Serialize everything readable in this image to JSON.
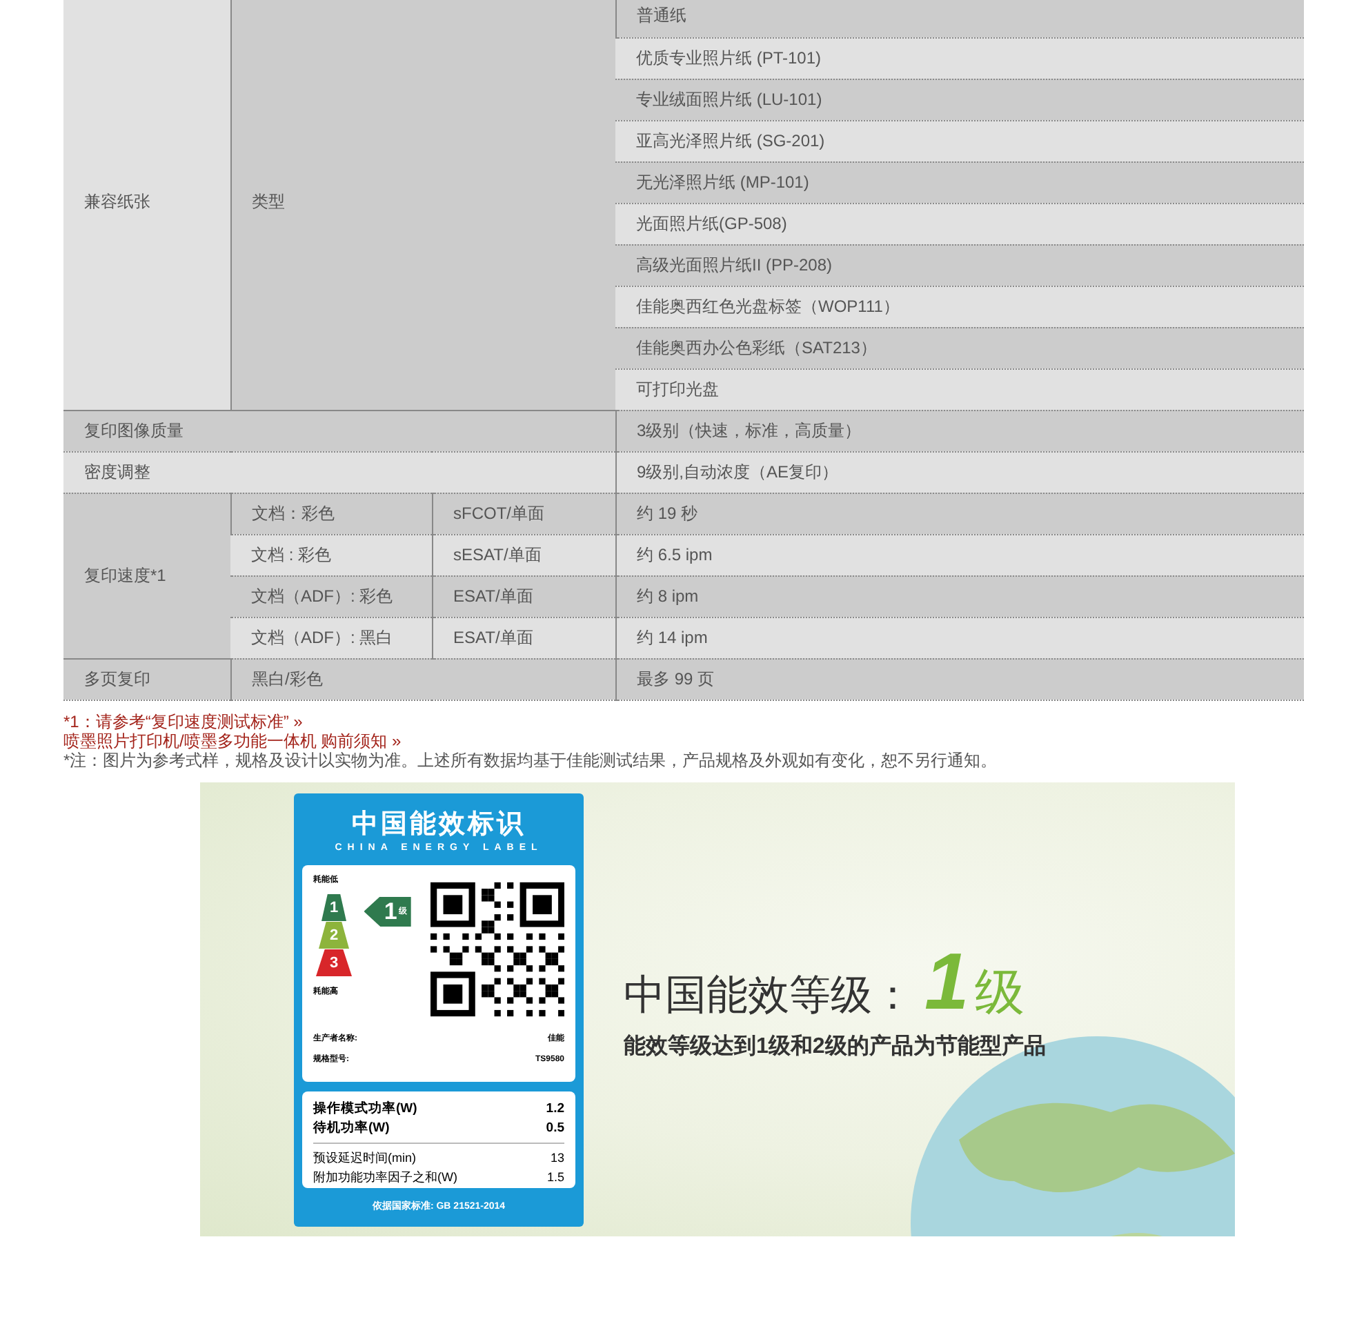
{
  "spec_table": {
    "rows": [
      {
        "kind": "paper",
        "label": "兼容纸张",
        "sub_label": "类型",
        "values": [
          "普通纸",
          "优质专业照片纸 (PT-101)",
          "专业绒面照片纸 (LU-101)",
          "亚高光泽照片纸 (SG-201)",
          "无光泽照片纸 (MP-101)",
          "光面照片纸(GP-508)",
          "高级光面照片纸II (PP-208)",
          "佳能奥西红色光盘标签（WOP111）",
          "佳能奥西办公色彩纸（SAT213）",
          "可打印光盘"
        ]
      },
      {
        "kind": "simple",
        "label": "复印图像质量",
        "value": "3级别（快速，标准，高质量）"
      },
      {
        "kind": "simple",
        "label": "密度调整",
        "value": "9级别,自动浓度（AE复印）"
      },
      {
        "kind": "speed",
        "label": "复印速度*1",
        "items": [
          {
            "mode": "文档：彩色",
            "measure": "sFCOT/单面",
            "value": "约 19 秒"
          },
          {
            "mode": "文档 : 彩色",
            "measure": "sESAT/单面",
            "value": "约 6.5 ipm"
          },
          {
            "mode": "文档（ADF）: 彩色",
            "measure": "ESAT/单面",
            "value": "约 8 ipm"
          },
          {
            "mode": "文档（ADF）: 黑白",
            "measure": "ESAT/单面",
            "value": "约 14 ipm"
          }
        ]
      },
      {
        "kind": "pair",
        "label": "多页复印",
        "sub_label": "黑白/彩色",
        "value": "最多 99 页"
      }
    ]
  },
  "notes": [
    {
      "kind": "link",
      "text": "*1：请参考“复印速度测试标准” »"
    },
    {
      "kind": "link",
      "text": "喷墨照片打印机/喷墨多功能一体机 购前须知 »"
    },
    {
      "kind": "plain",
      "text": "*注：图片为参考式样，规格及设计以实物为准。上述所有数据均基于佳能测试结果，产品规格及外观如有变化，恕不另行通知。"
    }
  ],
  "energy_banner": {
    "label": {
      "title": "中国能效标识",
      "subtitle": "CHINA ENERGY LABEL",
      "low_label": "耗能低",
      "high_label": "耗能高",
      "grades": [
        {
          "text": "1",
          "color": "#2f7a4e"
        },
        {
          "text": "2",
          "color": "#8db43c"
        },
        {
          "text": "3",
          "color": "#d8262a"
        }
      ],
      "rating": {
        "number": "1",
        "unit": "级"
      },
      "fields": [
        {
          "name": "生产者名称:",
          "value": "佳能"
        },
        {
          "name": "规格型号:",
          "value": "TS9580"
        }
      ],
      "specs": [
        {
          "kind": "major",
          "name": "操作模式功率(W)",
          "value": "1.2"
        },
        {
          "kind": "major",
          "name": "待机功率(W)",
          "value": "0.5"
        },
        {
          "kind": "minor",
          "name": "预设延迟时间(min)",
          "value": "13"
        },
        {
          "kind": "minor",
          "name": "附加功能功率因子之和(W)",
          "value": "1.5"
        }
      ],
      "standard": "依据国家标准: GB 21521-2014"
    },
    "headline": {
      "text": "中国能效等级：",
      "grade": "1",
      "unit": "级"
    },
    "description": "能效等级达到1级和2级的产品为节能型产品"
  }
}
